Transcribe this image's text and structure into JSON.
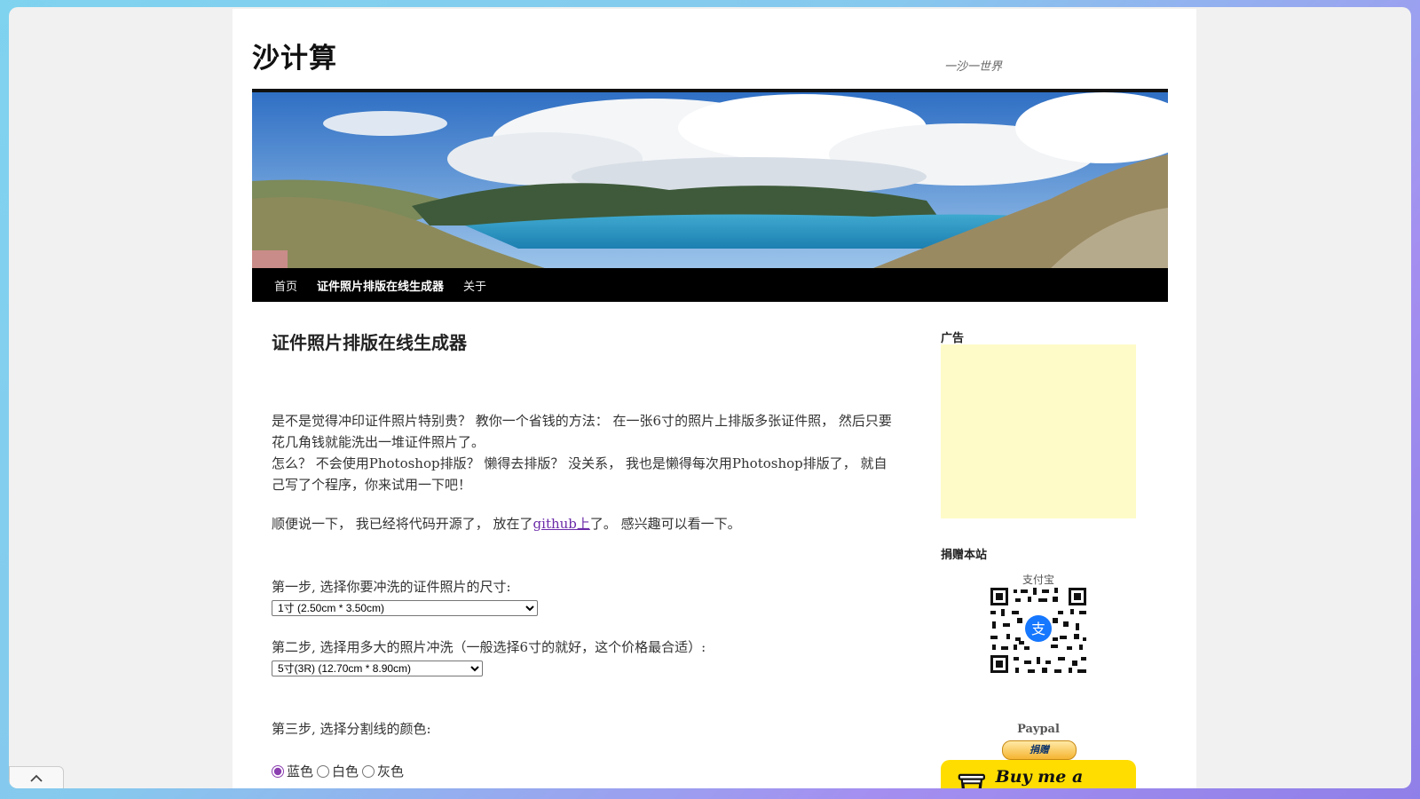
{
  "site": {
    "title": "沙计算",
    "tagline": "一沙一世界"
  },
  "nav": {
    "items": [
      "首页",
      "证件照片排版在线生成器",
      "关于"
    ],
    "active_index": 1
  },
  "main": {
    "title": "证件照片排版在线生成器",
    "intro_p1_line1": "是不是觉得冲印证件照片特别贵？ 教你一个省钱的方法： 在一张6寸的照片上排版多张证件照， 然后只要花几角钱就能洗出一堆证件照片了。",
    "intro_p1_line2": "怎么？ 不会使用Photoshop排版？ 懒得去排版？ 没关系， 我也是懒得每次用Photoshop排版了， 就自己写了个程序，你来试用一下吧！",
    "intro_p2_before": "顺便说一下， 我已经将代码开源了， 放在了",
    "intro_p2_link": "github上",
    "intro_p2_after": "了。 感兴趣可以看一下。",
    "step1_label": "第一步, 选择你要冲洗的证件照片的尺寸:",
    "step1_value": "1寸 (2.50cm * 3.50cm)",
    "step2_label": "第二步, 选择用多大的照片冲洗（一般选择6寸的就好，这个价格最合适）:",
    "step2_value": "5寸(3R) (12.70cm * 8.90cm)",
    "step3_label": "第三步, 选择分割线的颜色:",
    "step3_options": [
      "蓝色",
      "白色",
      "灰色"
    ],
    "step3_selected": "蓝色"
  },
  "sidebar": {
    "ad_title": "广告",
    "donate_title": "捐赠本站",
    "alipay_label": "支付宝",
    "paypal_label": "Paypal",
    "paypal_button": "捐赠",
    "bmc_label": "Buy me a coffee"
  },
  "colors": {
    "nav_bg": "#000000",
    "link": "#6b2ba8",
    "ad_bg": "#fffbc8",
    "bmc_bg": "#ffdd00"
  },
  "icons": {
    "coffee": "coffee-cup-icon",
    "collapse": "chevron-up-icon",
    "alipay": "alipay-logo-icon"
  }
}
